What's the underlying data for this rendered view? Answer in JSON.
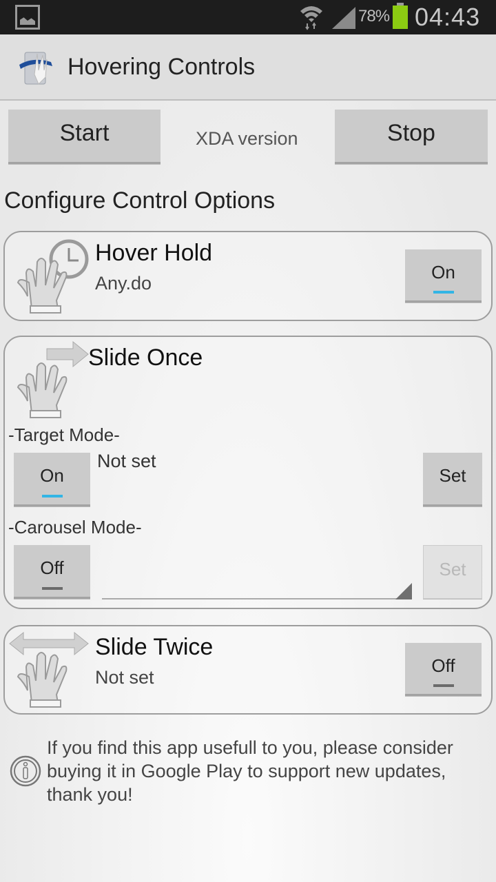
{
  "status_bar": {
    "icons": [
      "gallery-icon",
      "wifi-icon",
      "signal-icon",
      "battery-icon"
    ],
    "battery_percent": "78%",
    "time": "04:43",
    "battery_color": "#8ccc12"
  },
  "action_bar": {
    "app_icon": "hovering-controls-app-icon",
    "title": "Hovering Controls"
  },
  "toolbar": {
    "start_label": "Start",
    "version_label": "XDA version",
    "stop_label": "Stop"
  },
  "section_title": "Configure Control Options",
  "accent_color": "#33b5e5",
  "controls": {
    "hover_hold": {
      "icon": "hand-clock-icon",
      "title": "Hover Hold",
      "subtitle": "Any.do",
      "toggle_label": "On",
      "toggle_state": "on"
    },
    "slide_once": {
      "icon": "hand-arrow-right-icon",
      "title": "Slide Once",
      "target_mode": {
        "label": "-Target Mode-",
        "toggle_label": "On",
        "toggle_state": "on",
        "value": "Not set",
        "set_label": "Set"
      },
      "carousel_mode": {
        "label": "-Carousel Mode-",
        "toggle_label": "Off",
        "toggle_state": "off",
        "spinner_value": "",
        "set_label": "Set",
        "set_enabled": false
      }
    },
    "slide_twice": {
      "icon": "hand-arrows-left-right-icon",
      "title": "Slide Twice",
      "subtitle": "Not set",
      "toggle_label": "Off",
      "toggle_state": "off"
    }
  },
  "footer": {
    "icon": "info-icon",
    "message": "If you find this app usefull to you, please consider buying it in Google Play to support new updates, thank you!"
  }
}
